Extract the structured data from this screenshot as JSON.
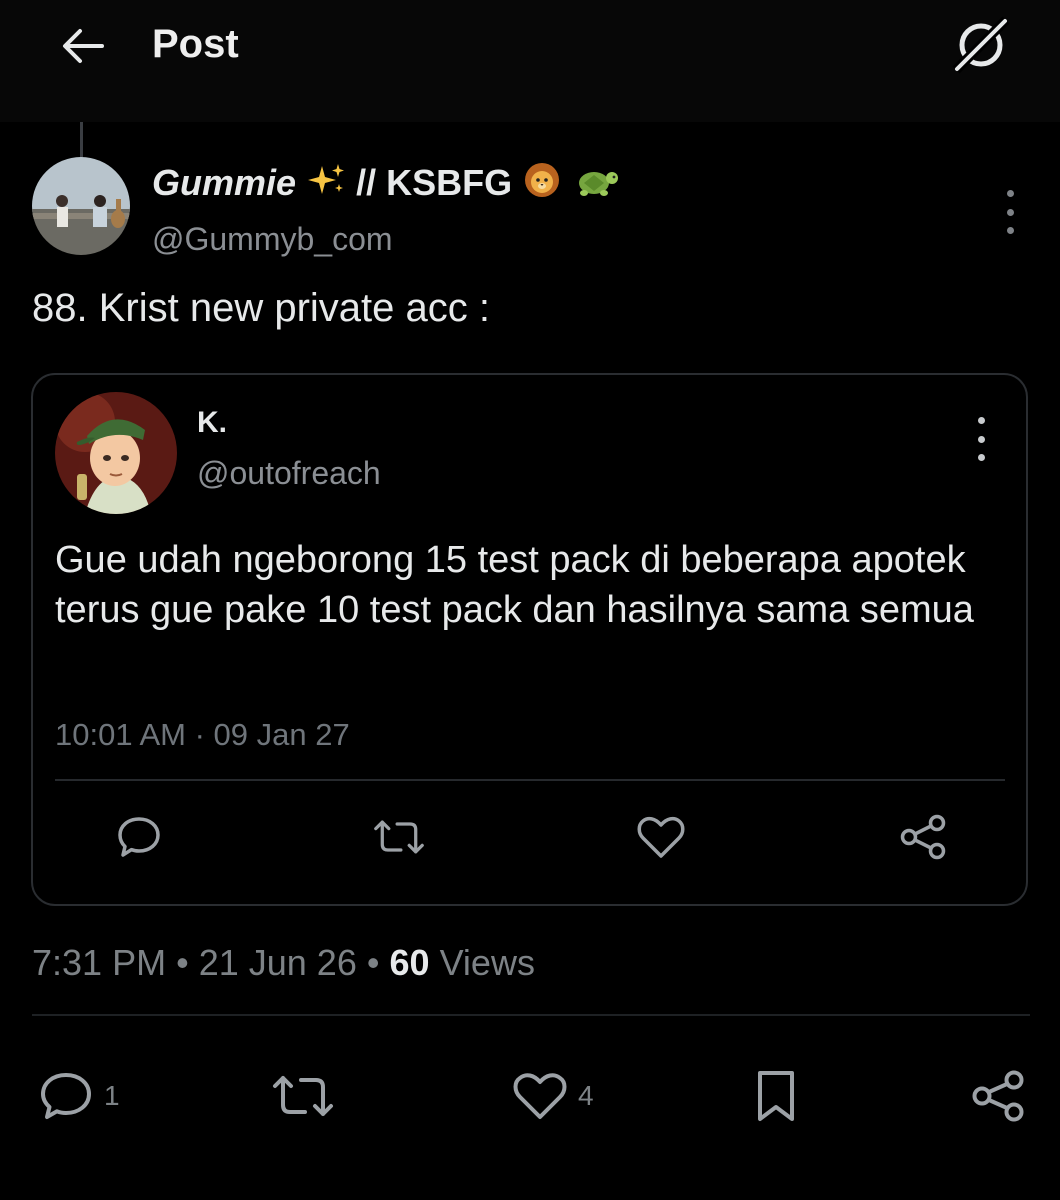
{
  "header": {
    "title": "Post"
  },
  "post": {
    "author": {
      "name": "Gummie",
      "name_suffix": "// KSBFG",
      "handle": "@Gummyb_com"
    },
    "text": "88. Krist new private acc :",
    "timestamp": "7:31 PM",
    "date": "21 Jun 26",
    "views_count": "60",
    "views_label": "Views",
    "separator": "•",
    "actions": {
      "reply_count": "1",
      "like_count": "4"
    }
  },
  "quoted": {
    "name": "K.",
    "handle": "@outofreach",
    "text": "Gue udah ngeborong 15 test pack di beberapa apotek terus gue pake 10 test pack dan hasilnya sama semua",
    "time": "10:01 AM · 09 Jan 27"
  },
  "colors": {
    "background": "#000000",
    "text_primary": "#e7e9ea",
    "text_secondary": "#8b8f94",
    "border": "#2a2d31"
  }
}
